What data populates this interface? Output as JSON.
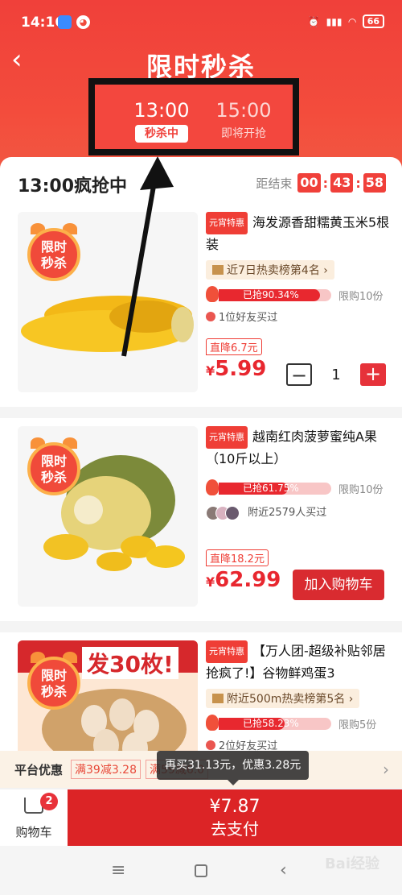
{
  "status": {
    "time": "14:16",
    "battery": "66"
  },
  "header": {
    "title": "限时秒杀"
  },
  "tabs": [
    {
      "time": "13:00",
      "status": "秒杀中"
    },
    {
      "time": "15:00",
      "status": "即将开抢"
    }
  ],
  "section": {
    "title": "13:00疯抢中",
    "countdown_label": "距结束",
    "hh": "00",
    "mm": "43",
    "ss": "58"
  },
  "badge": {
    "line1": "限时",
    "line2": "秒杀"
  },
  "products": [
    {
      "tag": "元宵特惠",
      "name": "海发源香甜糯黄玉米5根装",
      "rank": "近7日热卖榜第4名 ›",
      "progress_text": "已抢90.34%",
      "progress": 0.9034,
      "limit": "限购10份",
      "social": "1位好友买过",
      "drop": "直降6.7元",
      "currency": "¥",
      "price": "5.99",
      "qty": "1"
    },
    {
      "tag": "元宵特惠",
      "name": "越南红肉菠萝蜜纯A果（10斤以上）",
      "progress_text": "已抢61.75%",
      "progress": 0.6175,
      "limit": "限购10份",
      "social": "附近2579人买过",
      "drop": "直降18.2元",
      "currency": "¥",
      "price": "62.99",
      "button": "加入购物车"
    },
    {
      "tag": "元宵特惠",
      "name": "【万人团-超级补贴邻居抢疯了!】谷物鲜鸡蛋3",
      "banner": "发30枚!",
      "rank": "附近500m热卖榜第5名 ›",
      "progress_text": "已抢58.23%",
      "progress": 0.5823,
      "limit": "限购5份",
      "social": "2位好友买过"
    }
  ],
  "promo": {
    "label": "平台优惠",
    "chip1": "满39减3.28",
    "chip2": "满59减6.0"
  },
  "tooltip": "再买31.13元，优惠3.28元",
  "cart": {
    "label": "购物车",
    "count": "2"
  },
  "pay": {
    "amount": "¥7.87",
    "label": "去支付"
  },
  "colors": {
    "primary": "#e8323a",
    "header": "#f0403a"
  }
}
